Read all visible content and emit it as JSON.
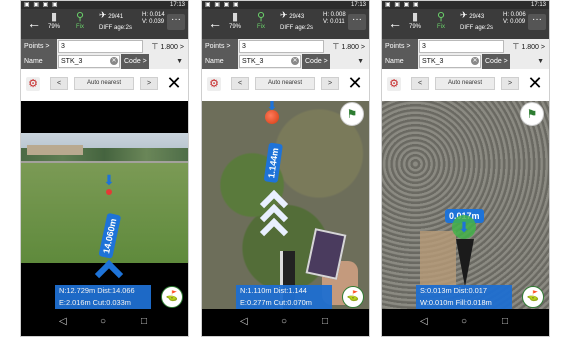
{
  "screens": [
    {
      "status_time": "17:13",
      "battery": "79%",
      "fix": "Fix",
      "sats": "29/41",
      "diff_age": "DIFF age:2s",
      "h_error": "H: 0.014",
      "v_error": "V: 0.039",
      "points_label": "Points >",
      "points_value": "3",
      "distance": "1.800 >",
      "name_label": "Name",
      "name_value": "STK_3",
      "code_label": "Code >",
      "mode": "Auto nearest",
      "prev": "<",
      "next": ">",
      "distance_label": "14.060m",
      "info_line1": "N:12.729m Dist:14.066",
      "info_line2": "E:2.016m  Cut:0.033m"
    },
    {
      "status_time": "17:13",
      "battery": "79%",
      "fix": "Fix",
      "sats": "29/43",
      "diff_age": "DIFF age:2s",
      "h_error": "H: 0.008",
      "v_error": "V: 0.011",
      "points_label": "Points >",
      "points_value": "3",
      "distance": "1.800 >",
      "name_label": "Name",
      "name_value": "STK_3",
      "code_label": "Code >",
      "mode": "Auto nearest",
      "prev": "<",
      "next": ">",
      "distance_label": "1.144m",
      "info_line1": "N:1.110m  Dist:1.144",
      "info_line2": "E:0.277m  Cut:0.070m"
    },
    {
      "status_time": "17:13",
      "battery": "79%",
      "fix": "Fix",
      "sats": "29/43",
      "diff_age": "DIFF age:2s",
      "h_error": "H: 0.006",
      "v_error": "V: 0.009",
      "points_label": "Points >",
      "points_value": "3",
      "distance": "1.800 >",
      "name_label": "Name",
      "name_value": "STK_3",
      "code_label": "Code >",
      "mode": "Auto nearest",
      "prev": "<",
      "next": ">",
      "distance_label": "0.017m",
      "info_line1": "S:0.013m  Dist:0.017",
      "info_line2": "W:0.010m  Fill:0.018m"
    }
  ],
  "icons": {
    "back": "←",
    "close": "✕",
    "menu": "···",
    "gear": "⚙",
    "dropdown": "▼",
    "clear": "✕",
    "down_arrow": "⬇",
    "nav_back": "◁",
    "nav_home": "○",
    "nav_recent": "□"
  },
  "colors": {
    "accent_blue": "#1e73d8",
    "target_red": "#e53935",
    "fix_green": "#6bd36b"
  }
}
